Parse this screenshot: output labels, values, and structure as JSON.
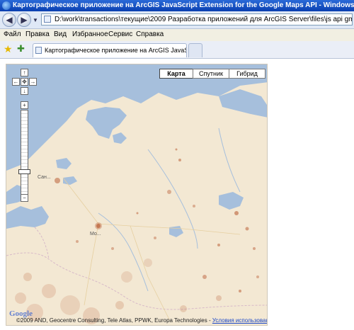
{
  "window": {
    "title": "Картографическое приложение на ArcGIS JavaScript Extension for the Google Maps API - Windows Internet Explorer"
  },
  "address_bar": {
    "url": "D:\\work\\transactions\\текущие\\2009 Разработка приложений для ArcGIS Server\\files\\js api gmaps\\gmap.html",
    "back_icon": "back-arrow-icon",
    "forward_icon": "forward-arrow-icon"
  },
  "menu": {
    "items": [
      "Файл",
      "Правка",
      "Вид",
      "Избранное",
      "Сервис",
      "Справка"
    ]
  },
  "tabs": {
    "active_label": "Картографическое приложение на ArcGIS JavaScri..."
  },
  "map": {
    "map_types": [
      "Карта",
      "Спутник",
      "Гибрид"
    ],
    "active_map_type": "Карта",
    "zoom_in": "+",
    "zoom_out": "−",
    "pan_center": "✥",
    "cities": [
      {
        "name": "Сан..."
      },
      {
        "name": "Мо..."
      }
    ],
    "copyright_text": "©2009 AND, Geocentre Consulting, Tele Atlas, PPWK, Europa Technologies - ",
    "terms_link": "Условия использования",
    "google_logo": "Google",
    "colors": {
      "land": "#f3e8d3",
      "water": "#a6bfdc",
      "population_dots": "#b5532a"
    }
  }
}
